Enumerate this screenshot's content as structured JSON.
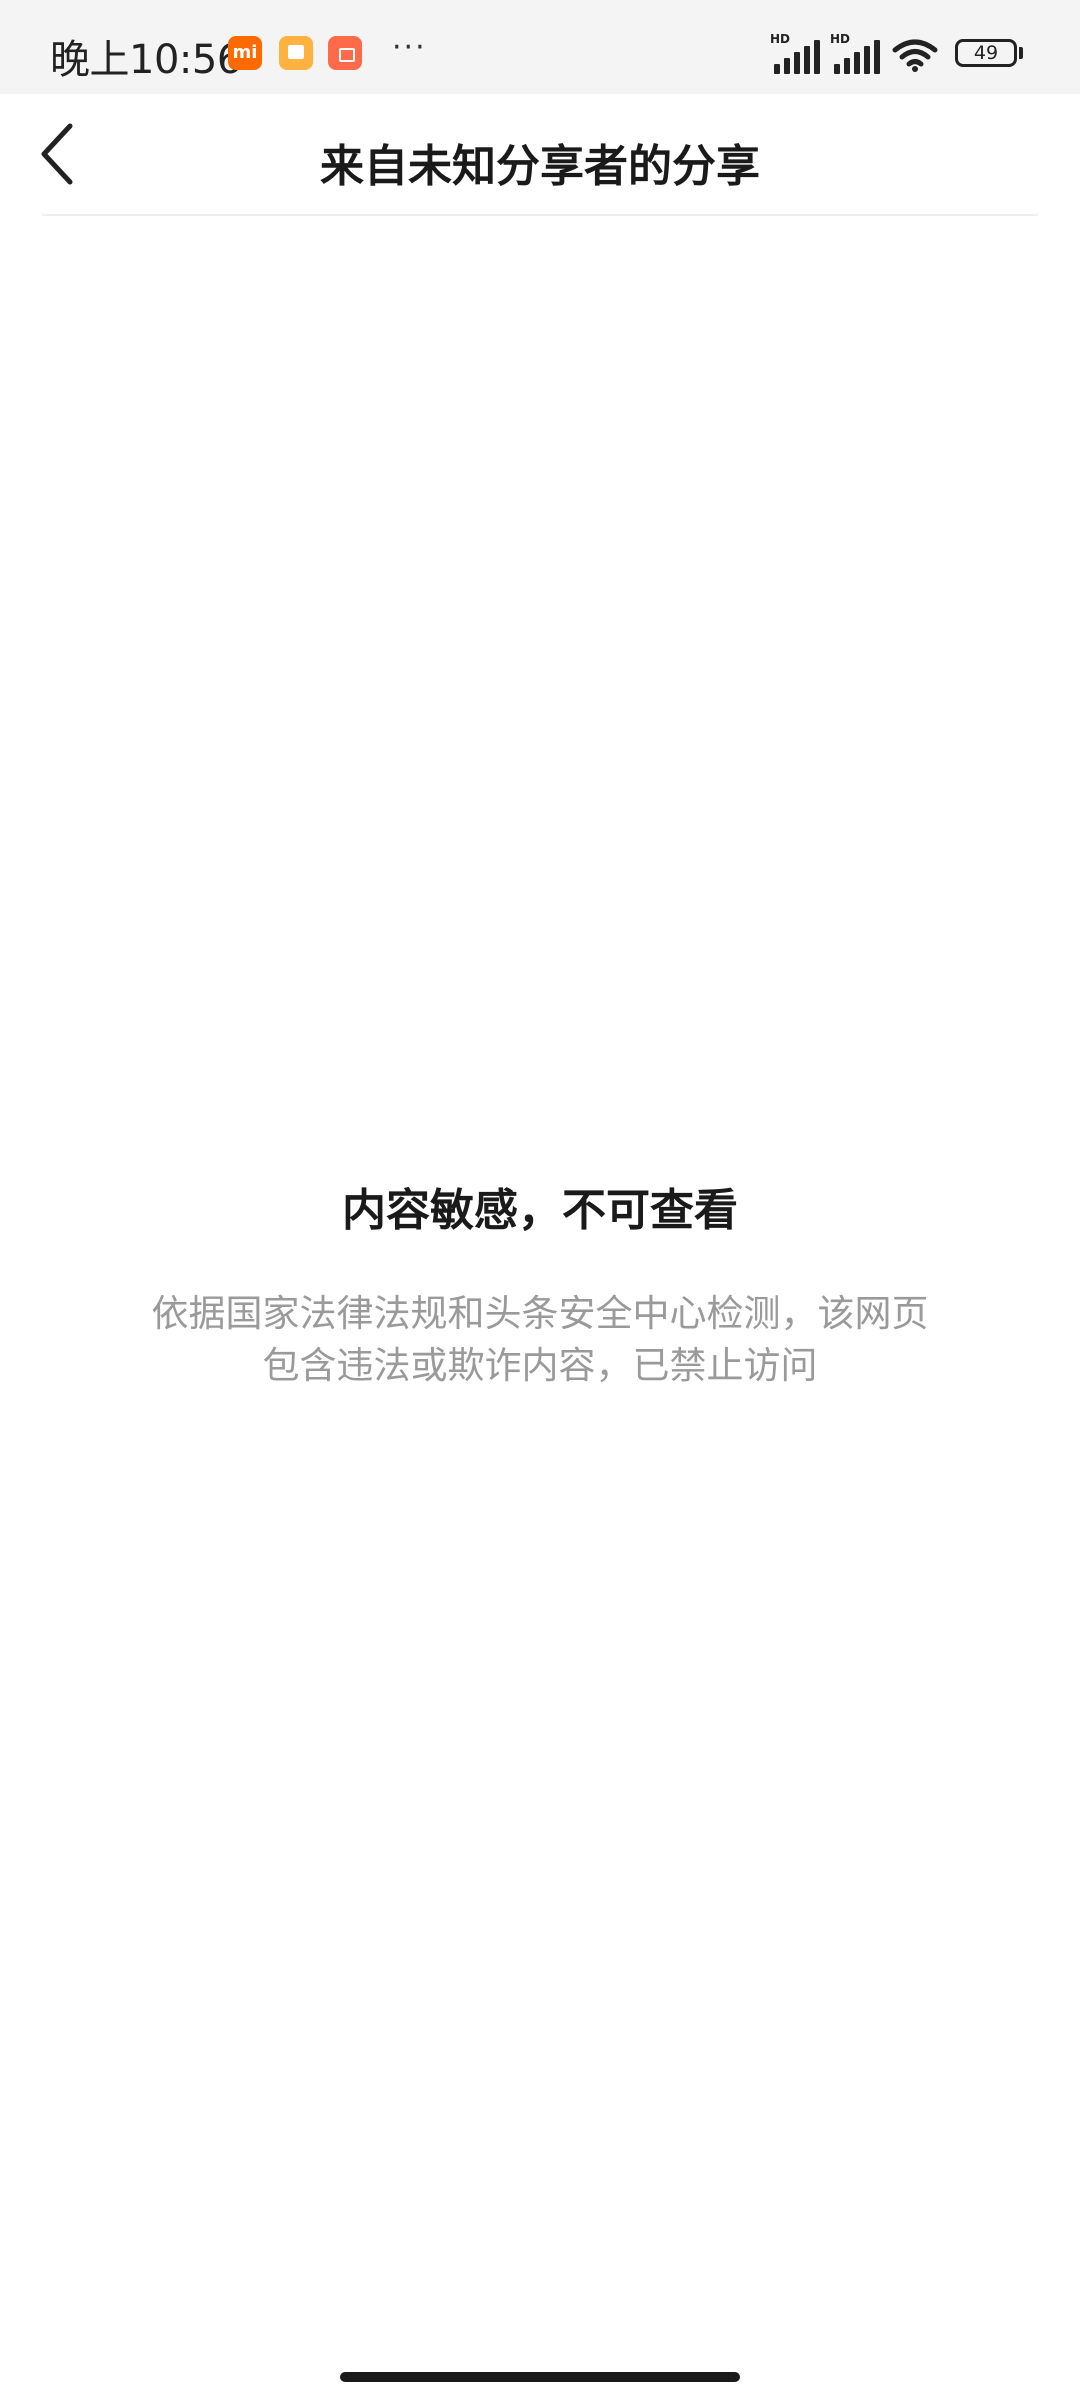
{
  "status_bar": {
    "time": "晚上10:56",
    "notification_icons": [
      "mi-app-icon",
      "notes-icon",
      "shop-icon"
    ],
    "more_indicator": "···",
    "signal_label": "HD",
    "battery_level": "49"
  },
  "header": {
    "title": "来自未知分享者的分享",
    "back_icon": "chevron-left-icon"
  },
  "notice": {
    "title": "内容敏感，不可查看",
    "description": "依据国家法律法规和头条安全中心检测，该网页包含违法或欺诈内容，已禁止访问"
  }
}
